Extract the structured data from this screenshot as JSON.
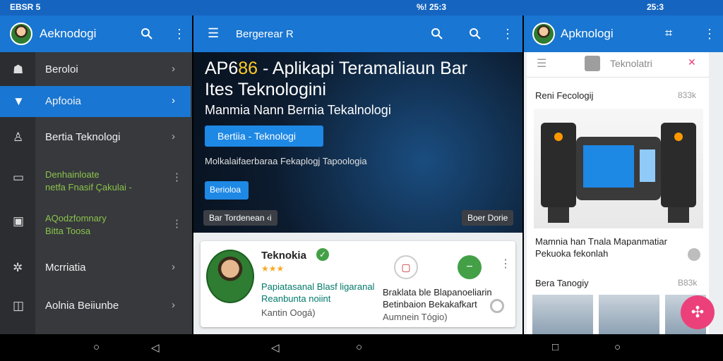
{
  "status": {
    "left": "EBSR 5",
    "mid": "%! 25:3",
    "right": "25:3"
  },
  "left_app": {
    "title": "Aeknodogi"
  },
  "mid_app": {
    "title": "Bergerear R"
  },
  "right_app": {
    "title": "Apknologi"
  },
  "drawer": {
    "items": [
      {
        "label": "Beroloi",
        "icon": "person-icon"
      },
      {
        "label": "Apfooia",
        "icon": "store-icon",
        "active": true
      },
      {
        "label": "Bertia Teknologi",
        "icon": "account-icon"
      },
      {
        "label": "Denhainloate",
        "sub": "netfa Fnasif Çakulai -",
        "icon": "monitor-icon"
      },
      {
        "label": "AQodzfomnary",
        "sub": "Bitta Toosa",
        "icon": "book-icon"
      },
      {
        "label": "Mcrriatia",
        "icon": "settings-icon"
      },
      {
        "label": "Aolnia Beiiunbe",
        "icon": "panel-icon"
      }
    ]
  },
  "hero": {
    "title_pre": "AP6",
    "title_hl": "86",
    "title_post": " - Aplikapi Teramaliaun Bar",
    "title_line2": "Ites Teknologini",
    "subtitle": "Manmia Nann Bernia Tekalnologi",
    "primary_button": "Bertiia - Teknologi",
    "description": "Molkalaifaerbaraa Fekaplogj  Tapoologia",
    "small_button": "Berioloa",
    "chip_left": "Bar Tordenean ‹i",
    "chip_right": "Boer Dorie"
  },
  "card": {
    "name": "Teknokia",
    "rating_stars": "★★★",
    "desc_green": "Papiatasanal Blasf ligaranal Reanbunta noiint",
    "author": "Kantin Oogá)",
    "right_text": "Braklata ble Blapanoeliarin Betinbaion Bekakafkart",
    "right_sub": "Aumnein Tógio)"
  },
  "right_panel": {
    "tab_title": "Teknolatri",
    "section1": "Reni Fecologij",
    "section1_count": "833k",
    "caption": "Mamnia han Tnala Mapanmatiar Pekuoka fekonlah",
    "section2": "Bera Tanogiy",
    "section2_count": "B83k"
  },
  "colors": {
    "appbar": "#1976d2",
    "accent": "#1e88e5",
    "fab": "#ec407a",
    "green_text": "#8bc34a"
  }
}
